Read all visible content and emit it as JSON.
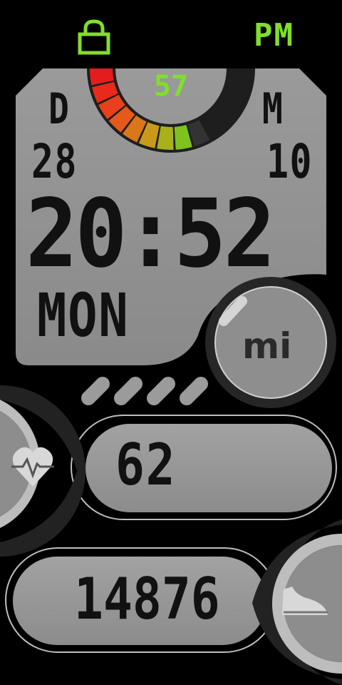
{
  "status": {
    "lock_icon": "lock-icon",
    "ampm": "PM",
    "accent_color": "#7fe02a"
  },
  "battery": {
    "value": "57",
    "level": 0.57
  },
  "date": {
    "day_label": "D",
    "day": "28",
    "month_label": "M",
    "month": "10"
  },
  "time": "20:52",
  "weekday": "MON",
  "brand": "mi",
  "heart_rate": {
    "icon": "heart-pulse-icon",
    "value": "62"
  },
  "steps": {
    "icon": "shoe-icon",
    "value": "14876"
  }
}
